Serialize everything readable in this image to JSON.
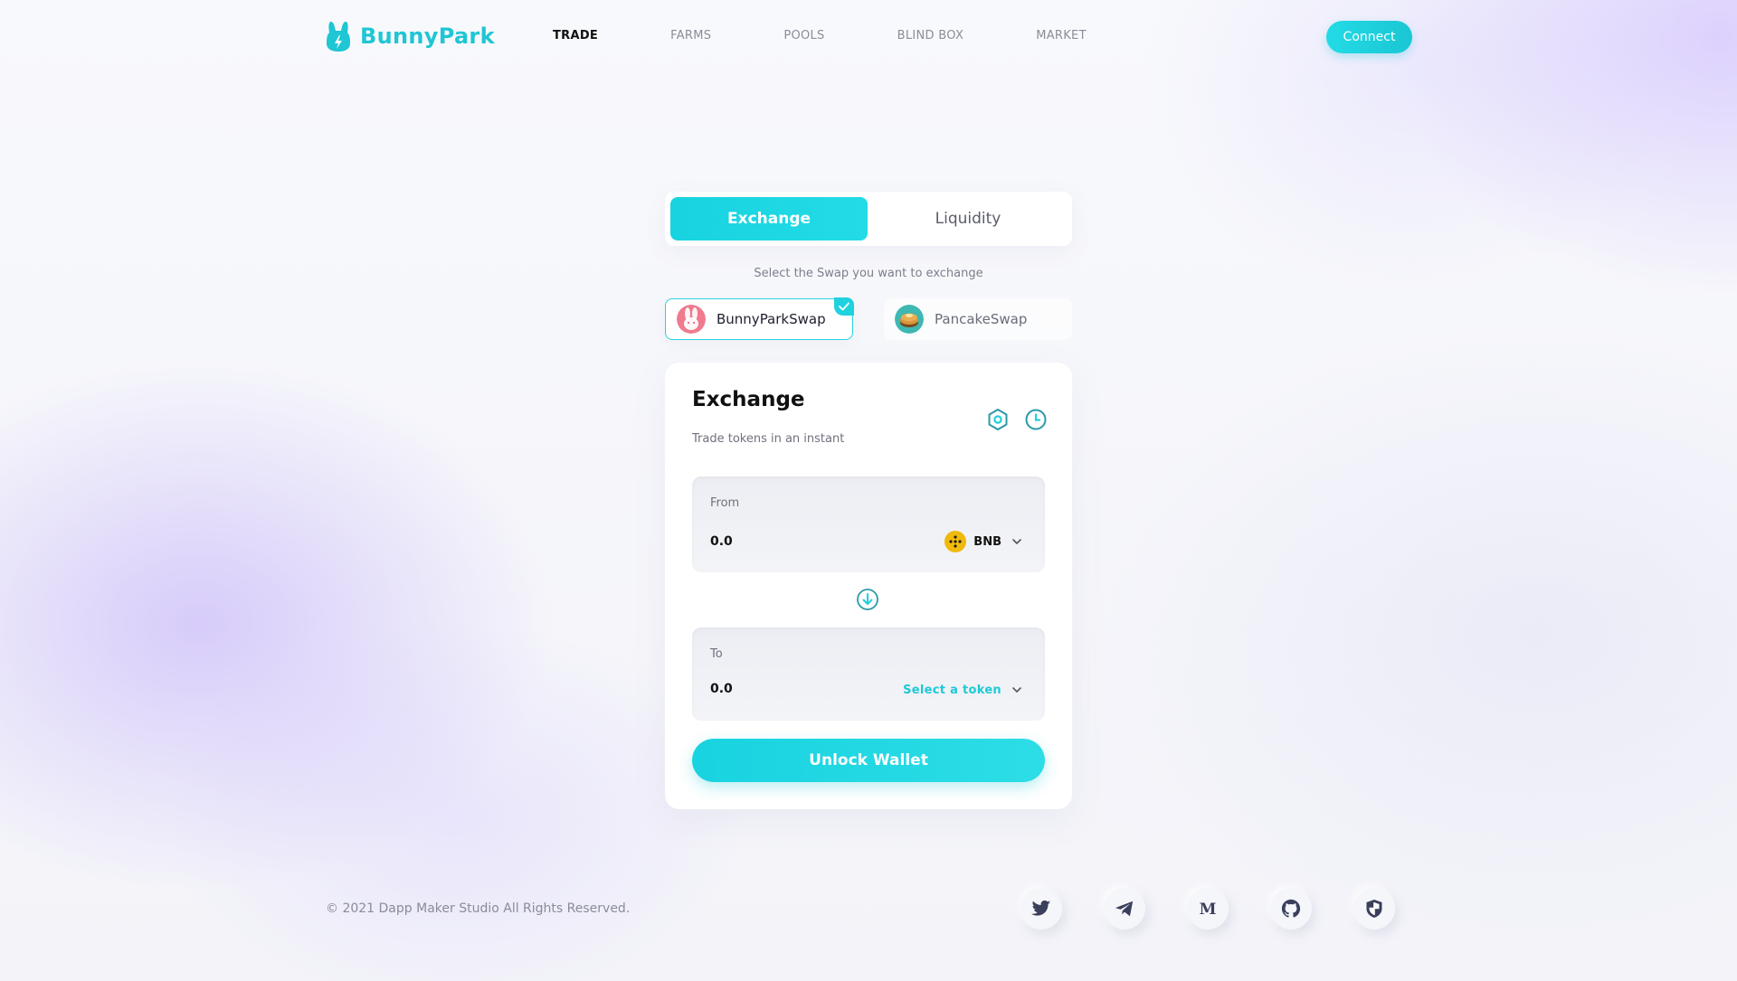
{
  "brand": {
    "name": "BunnyPark"
  },
  "nav": {
    "items": [
      {
        "label": "TRADE"
      },
      {
        "label": "FARMS"
      },
      {
        "label": "POOLS"
      },
      {
        "label": "BLIND BOX"
      },
      {
        "label": "MARKET"
      }
    ],
    "active": "TRADE",
    "connect_label": "Connect"
  },
  "tabs": [
    {
      "label": "Exchange",
      "active": true
    },
    {
      "label": "Liquidity",
      "active": false
    }
  ],
  "swap_select": {
    "caption": "Select the Swap you want to exchange",
    "options": [
      {
        "label": "BunnyParkSwap",
        "selected": true
      },
      {
        "label": "PancakeSwap",
        "selected": false
      }
    ]
  },
  "exchange": {
    "title": "Exchange",
    "subtitle": "Trade tokens in an instant",
    "from": {
      "label": "From",
      "value": "0.0",
      "token": "BNB"
    },
    "to": {
      "label": "To",
      "value": "0.0",
      "token_placeholder": "Select a token"
    },
    "unlock_label": "Unlock Wallet"
  },
  "footer": {
    "copyright": "© 2021 Dapp Maker Studio All Rights Reserved.",
    "socials": [
      "twitter-icon",
      "telegram-icon",
      "medium-icon",
      "github-icon",
      "audit-shield-icon"
    ]
  },
  "colors": {
    "accent": "#1fc6d4",
    "text_dark": "#111111",
    "muted": "#8a8c99",
    "bnb": "#f0b90b"
  }
}
